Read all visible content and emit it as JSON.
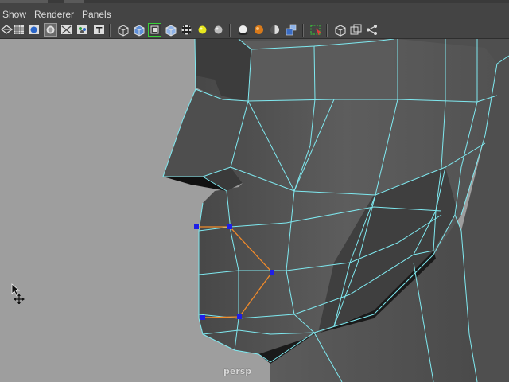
{
  "menu": {
    "items": [
      "Show",
      "Renderer",
      "Panels"
    ]
  },
  "toolbar": {
    "icons": [
      "wireframe-on-shaded-icon",
      "grid-icon",
      "shaded-sphere-icon",
      "smooth-shade-icon",
      "xray-icon",
      "isolate-select-icon",
      "text-texture-icon",
      "wireframe-cube-icon",
      "smooth-shaded-cube-icon",
      "selected-cube-highlight-icon",
      "textured-cube-icon",
      "checker-texture-icon",
      "light-yellow-icon",
      "light-gray-icon",
      "shadow-sphere-icon",
      "orange-sphere-icon",
      "half-sphere-icon",
      "blue-cubes-icon",
      "select-highlight-icon",
      "camera-cube-icon",
      "two-panes-icon",
      "share-icon"
    ]
  },
  "viewport": {
    "camera_label": "persp",
    "colors": {
      "background": "#9e9e9e",
      "mesh_dark": "#4a4a4a",
      "mesh_mid": "#595959",
      "wire": "#7fe9f0",
      "selected_edge": "#f08a2a",
      "selected_vertex": "#1f1fe6"
    }
  }
}
